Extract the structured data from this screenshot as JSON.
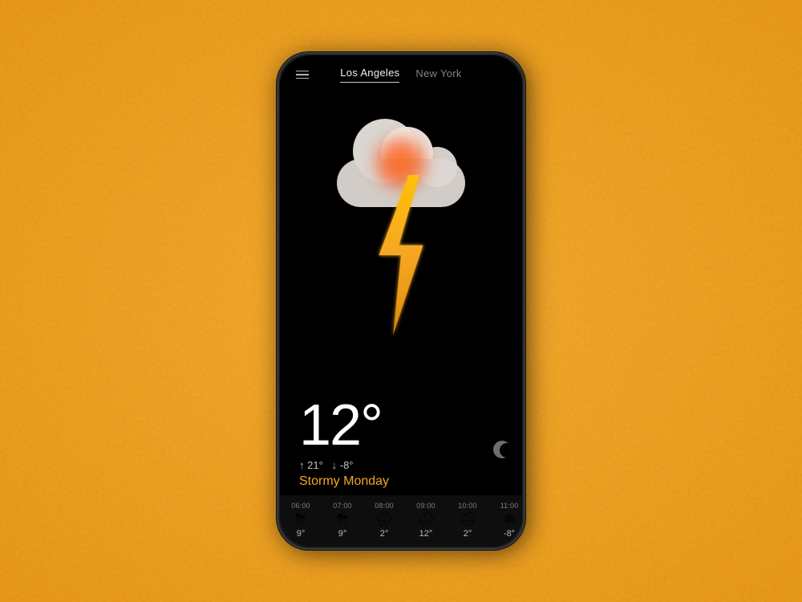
{
  "background": {
    "color": "#F5A623"
  },
  "phone": {
    "screen": {
      "nav": {
        "menu_icon": "≡",
        "cities": [
          {
            "label": "Los Angeles",
            "active": true
          },
          {
            "label": "New York",
            "active": false
          }
        ]
      },
      "weather": {
        "temperature": "12°",
        "temp_high": "↑ 21°",
        "temp_low": "↓ -8°",
        "condition": "Stormy Monday",
        "weather_icon": "⚡",
        "cloud_icon": "☁"
      },
      "hourly": [
        {
          "time": "06:00",
          "icon": "⛈",
          "temp": "9°"
        },
        {
          "time": "07:00",
          "icon": "⛈",
          "temp": "9°"
        },
        {
          "time": "08:00",
          "icon": "🌧",
          "temp": "2°"
        },
        {
          "time": "09:00",
          "icon": "🌧",
          "temp": "12°"
        },
        {
          "time": "10:00",
          "icon": "🌧",
          "temp": "2°"
        },
        {
          "time": "11:00",
          "icon": "❄",
          "temp": "-8°"
        }
      ]
    }
  }
}
